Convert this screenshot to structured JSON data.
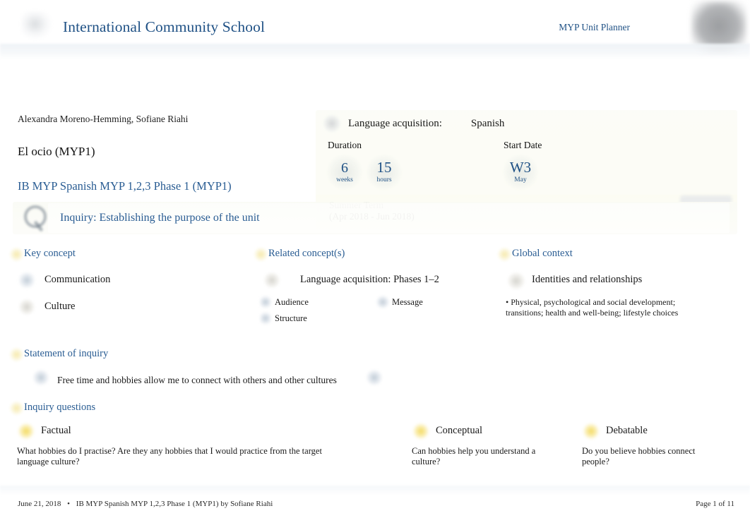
{
  "header": {
    "school_name": "International Community School",
    "planner_label": "MYP Unit Planner",
    "school_logo_icon": "school-crest-logo",
    "corner_logo_icon": "ib-world-school-logo"
  },
  "unit_info": {
    "authors": "Alexandra Moreno-Hemming, Sofiane Riahi",
    "unit_title": "El ocio (MYP1)",
    "course_link": "IB MYP Spanish MYP 1,2,3 Phase 1 (MYP1)"
  },
  "meta": {
    "subject_icon": "subject-group-icon",
    "subject_label": "Language acquisition:",
    "subject_value": "Spanish",
    "duration_caption": "Duration",
    "duration": [
      {
        "value": "6",
        "unit": "weeks"
      },
      {
        "value": "15",
        "unit": "hours"
      }
    ],
    "start_date_caption": "Start Date",
    "start_date": {
      "value": "W3",
      "unit": "May"
    },
    "term_name": "Summer Term",
    "term_range": "(Apr 2018 - Jun 2018)"
  },
  "inquiry": {
    "banner_icon": "magnifying-glass-icon",
    "banner_title": "Inquiry: Establishing the purpose of the unit",
    "key_concept": {
      "heading": "Key concept",
      "items": [
        {
          "label": "Communication",
          "icon": "key-concept-icon-blue"
        },
        {
          "label": "Culture",
          "icon": "key-concept-icon-gray"
        }
      ]
    },
    "related_concepts": {
      "heading": "Related concept(s)",
      "subject_line": "Language acquisition: Phases 1–2",
      "subject_icon": "subject-group-icon",
      "items": [
        {
          "label": "Audience",
          "icon": "related-concept-icon"
        },
        {
          "label": "Structure",
          "icon": "related-concept-icon"
        },
        {
          "label": "Message",
          "icon": "related-concept-icon"
        }
      ]
    },
    "global_context": {
      "heading": "Global context",
      "name": "Identities and relationships",
      "icon": "global-context-icon",
      "exploration": "• Physical, psychological and social development; transitions; health and well-being; lifestyle choices"
    },
    "statement": {
      "heading": "Statement of inquiry",
      "text": "Free time and hobbies allow me to connect with others and other cultures",
      "icon_left": "statement-icon",
      "icon_right": "statement-icon"
    },
    "questions": {
      "heading": "Inquiry questions",
      "items": [
        {
          "type": "Factual",
          "icon": "sun-icon",
          "text": "What hobbies do I practise? Are they any hobbies that I would practice from the target language culture?"
        },
        {
          "type": "Conceptual",
          "icon": "sun-icon",
          "text": "Can hobbies help you understand a culture?"
        },
        {
          "type": "Debatable",
          "icon": "sun-icon",
          "text": "Do you believe hobbies connect people?"
        }
      ]
    }
  },
  "footer": {
    "date": "June 21, 2018",
    "separator": "•",
    "source": "IB MYP Spanish MYP 1,2,3 Phase 1 (MYP1) by Sofiane Riahi",
    "page": "Page 1 of 11"
  },
  "colors": {
    "accent_blue": "#2a5d93",
    "heading_blue": "#1f5185",
    "panel_cream": "#fbfcf6",
    "text_dark": "#1a1a1a",
    "sun_gold": "#f2d64e"
  }
}
